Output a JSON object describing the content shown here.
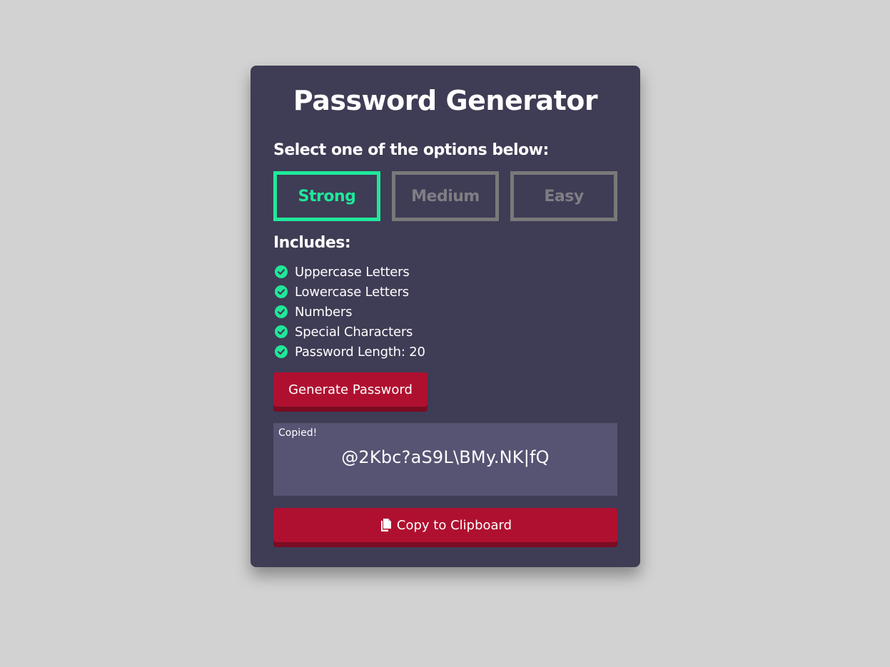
{
  "header": {
    "title": "Password Generator"
  },
  "options": {
    "prompt": "Select one of the options below:",
    "items": [
      {
        "label": "Strong",
        "selected": true
      },
      {
        "label": "Medium",
        "selected": false
      },
      {
        "label": "Easy",
        "selected": false
      }
    ]
  },
  "includes": {
    "title": "Includes:",
    "items": [
      {
        "label": "Uppercase Letters",
        "icon": "check-circle-icon"
      },
      {
        "label": "Lowercase Letters",
        "icon": "check-circle-icon"
      },
      {
        "label": "Numbers",
        "icon": "check-circle-icon"
      },
      {
        "label": "Special Characters",
        "icon": "check-circle-icon"
      },
      {
        "label": "Password Length: 20",
        "icon": "check-circle-icon"
      }
    ]
  },
  "actions": {
    "generate_label": "Generate Password",
    "copy_label": "Copy to Clipboard",
    "copy_icon": "copy-icon"
  },
  "output": {
    "status": "Copied!",
    "password": "@2Kbc?aS9L\\BMy.NK|fQ"
  },
  "colors": {
    "page_background": "#d2d2d2",
    "card_background": "#3f3c55",
    "accent_green": "#1fe89a",
    "button_red": "#b01030",
    "output_background": "#565373",
    "inactive_border": "#797979"
  }
}
